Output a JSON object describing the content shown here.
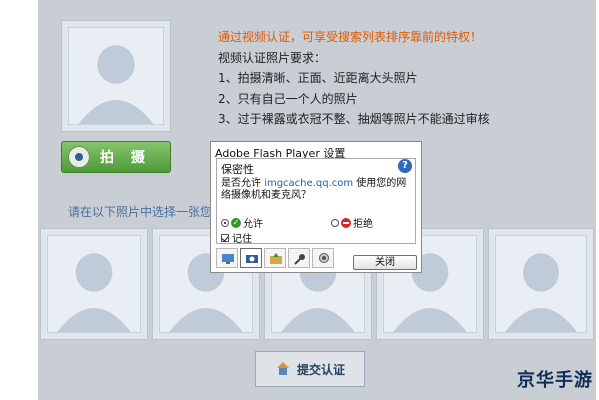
{
  "info": {
    "headline": "通过视频认证，可享受搜索列表排序靠前的特权！",
    "requirements_title": "视频认证照片要求：",
    "requirements": [
      "1、拍摄清晰、正面、近距离大头照片",
      "2、只有自己一个人的照片",
      "3、过于裸露或衣冠不整、抽烟等照片不能通过审核"
    ]
  },
  "capture_button": {
    "label": "拍 摄",
    "icon": "webcam-icon"
  },
  "choose_text": "请在以下照片中选择一张您",
  "submit_button": {
    "label": "提交认证",
    "icon": "home-icon"
  },
  "flash_dialog": {
    "title": "Adobe Flash Player 设置",
    "heading": "保密性",
    "message_prefix": "是否允许 ",
    "domain": "imgcache.qq.com",
    "message_suffix": " 使用您的网络摄像机和麦克风？",
    "allow_label": "允许",
    "deny_label": "拒绝",
    "remember_label": "记住",
    "close_label": "关闭",
    "tabs": [
      "display-icon",
      "privacy-icon",
      "storage-icon",
      "microphone-icon",
      "camera-icon"
    ]
  },
  "watermark": "京华手游",
  "colors": {
    "page_bg": "#c9cdd4",
    "headline": "#e05a00",
    "capture_button": "#5aa641",
    "link_text": "#4b6f9d"
  }
}
